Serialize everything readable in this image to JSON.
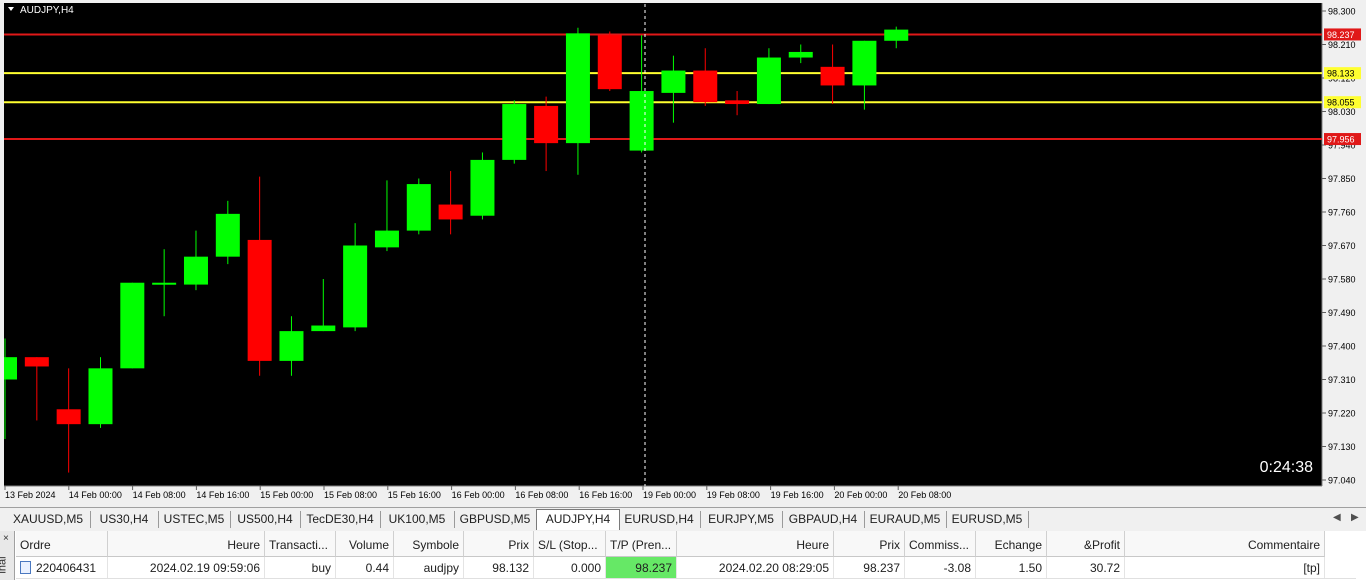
{
  "chart": {
    "symbol_title": "AUDJPY,H4",
    "countdown": "0:24:38",
    "colors": {
      "background": "#000000",
      "bull": "#00ff00",
      "bear": "#ff0000",
      "line_red": "#e01818",
      "line_yellow": "#ffff30",
      "axis_text": "#000000"
    },
    "price_axis": [
      "98.300",
      "98.210",
      "98.120",
      "98.030",
      "97.940",
      "97.850",
      "97.760",
      "97.670",
      "97.580",
      "97.490",
      "97.400",
      "97.310",
      "97.220",
      "97.130",
      "97.040"
    ],
    "time_axis": [
      "13 Feb 2024",
      "14 Feb 00:00",
      "14 Feb 08:00",
      "14 Feb 16:00",
      "15 Feb 00:00",
      "15 Feb 08:00",
      "15 Feb 16:00",
      "16 Feb 00:00",
      "16 Feb 08:00",
      "16 Feb 16:00",
      "19 Feb 00:00",
      "19 Feb 08:00",
      "19 Feb 16:00",
      "20 Feb 00:00",
      "20 Feb 08:00"
    ],
    "levels": [
      {
        "label": "98.237",
        "price": 98.237,
        "color": "red"
      },
      {
        "label": "98.133",
        "price": 98.133,
        "color": "yellow"
      },
      {
        "label": "98.055",
        "price": 98.055,
        "color": "yellow"
      },
      {
        "label": "97.956",
        "price": 97.956,
        "color": "red"
      }
    ],
    "candles": [
      {
        "o": 97.31,
        "h": 97.42,
        "l": 97.15,
        "c": 97.37
      },
      {
        "o": 97.37,
        "h": 97.37,
        "l": 97.2,
        "c": 97.345
      },
      {
        "o": 97.23,
        "h": 97.34,
        "l": 97.06,
        "c": 97.19
      },
      {
        "o": 97.19,
        "h": 97.37,
        "l": 97.18,
        "c": 97.34
      },
      {
        "o": 97.34,
        "h": 97.57,
        "l": 97.34,
        "c": 97.57
      },
      {
        "o": 97.565,
        "h": 97.66,
        "l": 97.48,
        "c": 97.57
      },
      {
        "o": 97.565,
        "h": 97.71,
        "l": 97.55,
        "c": 97.64
      },
      {
        "o": 97.64,
        "h": 97.79,
        "l": 97.62,
        "c": 97.755
      },
      {
        "o": 97.685,
        "h": 97.855,
        "l": 97.32,
        "c": 97.36
      },
      {
        "o": 97.36,
        "h": 97.48,
        "l": 97.32,
        "c": 97.44
      },
      {
        "o": 97.44,
        "h": 97.58,
        "l": 97.44,
        "c": 97.455
      },
      {
        "o": 97.45,
        "h": 97.73,
        "l": 97.44,
        "c": 97.67
      },
      {
        "o": 97.665,
        "h": 97.845,
        "l": 97.655,
        "c": 97.71
      },
      {
        "o": 97.71,
        "h": 97.85,
        "l": 97.7,
        "c": 97.835
      },
      {
        "o": 97.78,
        "h": 97.87,
        "l": 97.7,
        "c": 97.74
      },
      {
        "o": 97.75,
        "h": 97.92,
        "l": 97.74,
        "c": 97.9
      },
      {
        "o": 97.9,
        "h": 98.06,
        "l": 97.89,
        "c": 98.05
      },
      {
        "o": 98.045,
        "h": 98.07,
        "l": 97.87,
        "c": 97.945
      },
      {
        "o": 97.945,
        "h": 98.255,
        "l": 97.86,
        "c": 98.24
      },
      {
        "o": 98.235,
        "h": 98.245,
        "l": 98.085,
        "c": 98.09
      },
      {
        "o": 97.925,
        "h": 98.235,
        "l": 97.92,
        "c": 98.085
      },
      {
        "o": 98.08,
        "h": 98.18,
        "l": 98.0,
        "c": 98.14
      },
      {
        "o": 98.14,
        "h": 98.2,
        "l": 98.045,
        "c": 98.055
      },
      {
        "o": 98.06,
        "h": 98.085,
        "l": 98.02,
        "c": 98.05
      },
      {
        "o": 98.05,
        "h": 98.2,
        "l": 98.05,
        "c": 98.175
      },
      {
        "o": 98.175,
        "h": 98.21,
        "l": 98.16,
        "c": 98.19
      },
      {
        "o": 98.15,
        "h": 98.21,
        "l": 98.05,
        "c": 98.1
      },
      {
        "o": 98.1,
        "h": 98.22,
        "l": 98.035,
        "c": 98.22
      },
      {
        "o": 98.22,
        "h": 98.258,
        "l": 98.2,
        "c": 98.25
      }
    ]
  },
  "tabs": [
    {
      "label": "XAUUSD,M5",
      "active": false
    },
    {
      "label": "US30,H4",
      "active": false
    },
    {
      "label": "USTEC,M5",
      "active": false
    },
    {
      "label": "US500,H4",
      "active": false
    },
    {
      "label": "TecDE30,H4",
      "active": false
    },
    {
      "label": "UK100,M5",
      "active": false
    },
    {
      "label": "GBPUSD,M5",
      "active": false
    },
    {
      "label": "AUDJPY,H4",
      "active": true
    },
    {
      "label": "EURUSD,H4",
      "active": false
    },
    {
      "label": "EURJPY,M5",
      "active": false
    },
    {
      "label": "GBPAUD,H4",
      "active": false
    },
    {
      "label": "EURAUD,M5",
      "active": false
    },
    {
      "label": "EURUSD,M5",
      "active": false
    }
  ],
  "terminal": {
    "side_label": "inal",
    "columns": [
      "Ordre",
      "Heure",
      "Transacti...",
      "Volume",
      "Symbole",
      "Prix",
      "S/L (Stop...",
      "T/P (Pren...",
      "Heure",
      "Prix",
      "Commiss...",
      "Echange",
      "&Profit",
      "Commentaire"
    ],
    "row": [
      "220406431",
      "2024.02.19 09:59:06",
      "buy",
      "0.44",
      "audjpy",
      "98.132",
      "0.000",
      "98.237",
      "2024.02.20 08:29:05",
      "98.237",
      "-3.08",
      "1.50",
      "30.72",
      "[tp]"
    ]
  }
}
